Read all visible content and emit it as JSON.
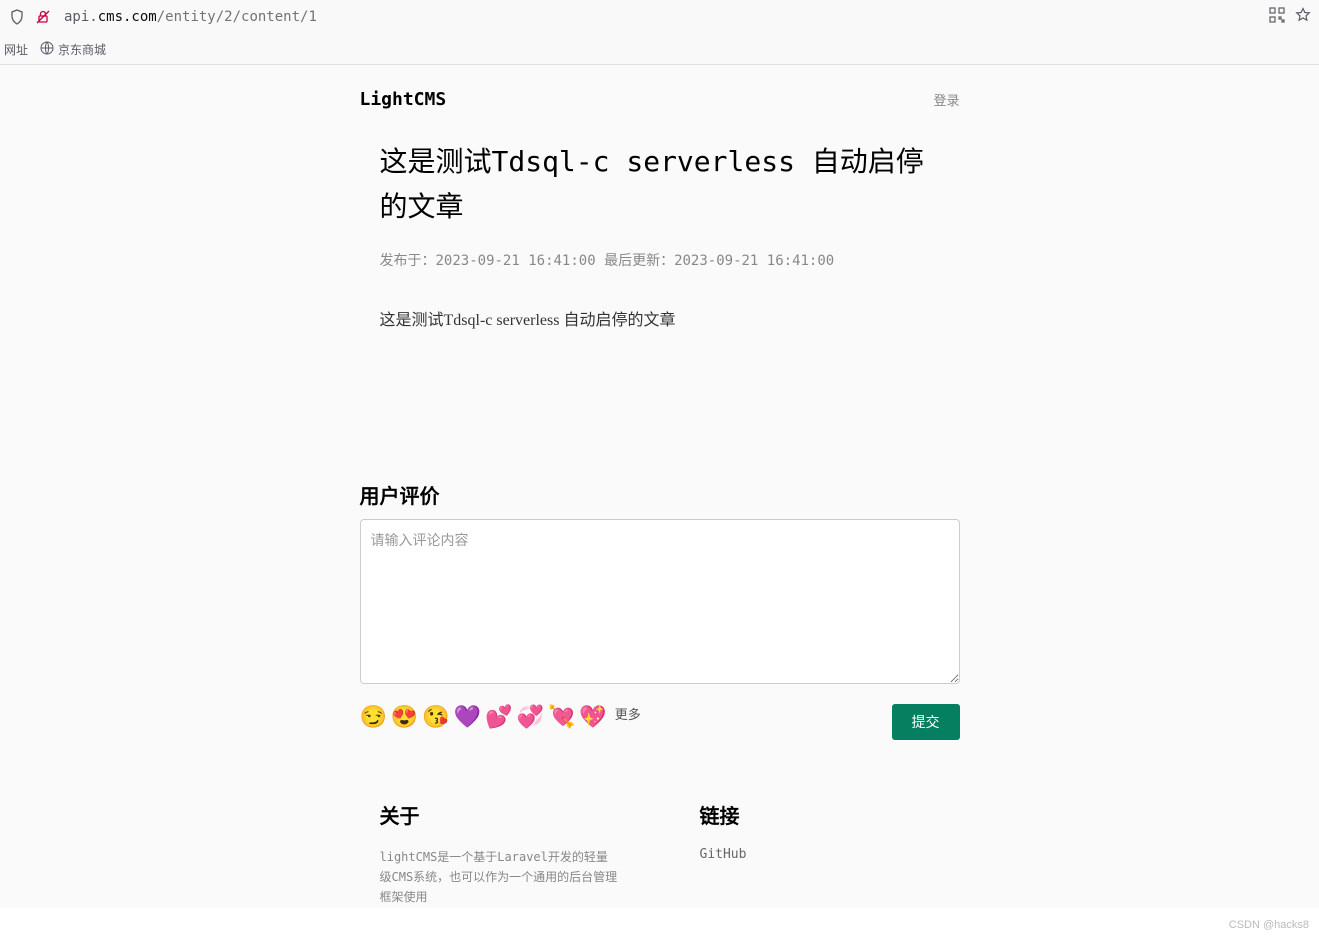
{
  "browser": {
    "url_protocol_path": "api.",
    "url_domain": "cms.com",
    "url_path": "/entity/2/content/1",
    "bookmark_label_1": "网址",
    "bookmark_label_2": "京东商城"
  },
  "header": {
    "brand": "LightCMS",
    "login": "登录"
  },
  "article": {
    "title": "这是测试Tdsql-c serverless 自动启停的文章",
    "meta": "发布于：2023-09-21 16:41:00 最后更新：2023-09-21 16:41:00",
    "content": "这是测试Tdsql-c serverless 自动启停的文章"
  },
  "comments": {
    "title": "用户评价",
    "placeholder": "请输入评论内容",
    "emojis": [
      "😏",
      "😍",
      "😘",
      "💜",
      "💕",
      "💞",
      "💘",
      "💖"
    ],
    "more": "更多",
    "submit": "提交"
  },
  "footer": {
    "about_title": "关于",
    "about_text": "lightCMS是一个基于Laravel开发的轻量级CMS系统，也可以作为一个通用的后台管理框架使用",
    "links_title": "链接",
    "link_github": "GitHub"
  },
  "watermark": "CSDN @hacks8"
}
